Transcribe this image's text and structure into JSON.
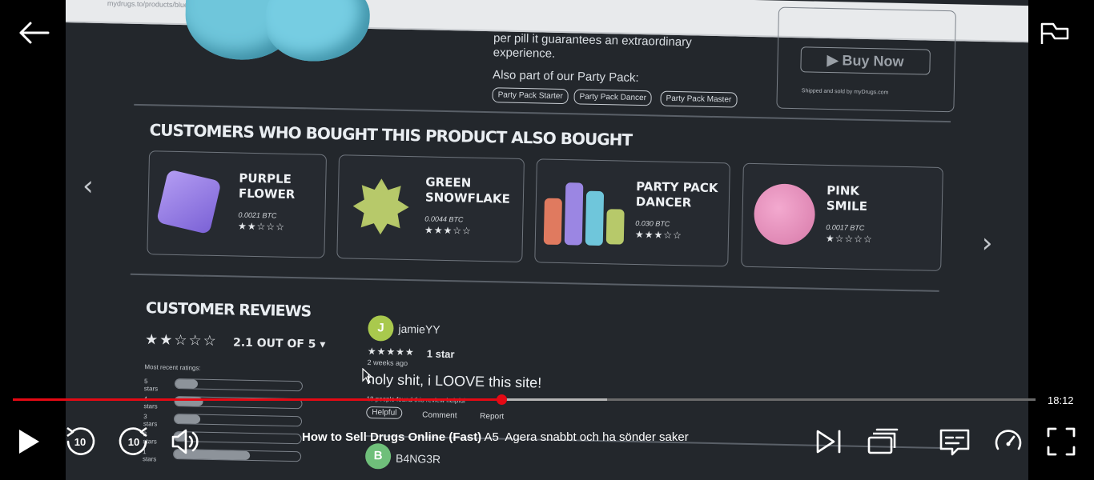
{
  "player": {
    "elapsed_fraction": 0.478,
    "buffered_fraction": 0.581,
    "remaining_time": "18:12",
    "show_title": "How to Sell Drugs Online (Fast)",
    "episode_code": "A5",
    "episode_title": "Agera snabbt och ha sönder saker",
    "skip_seconds": "10",
    "accent_color": "#e50914"
  },
  "video_frame": {
    "url": "mydrugs.to/products/blueclover",
    "description_lines": [
      "per pill it guarantees an extraordinary",
      "experience."
    ],
    "party_pack_title": "Also part of our Party Pack:",
    "party_pack_chips": [
      "Party Pack Starter",
      "Party Pack Dancer",
      "Party Pack Master"
    ],
    "buy_now": "Buy Now",
    "shipped_by": "Shipped and sold by myDrugs.com",
    "also_bought_title": "CUSTOMERS WHO BOUGHT THIS PRODUCT ALSO BOUGHT",
    "products": [
      {
        "name_line1": "PURPLE",
        "name_line2": "FLOWER",
        "price": "0.0021 BTC",
        "stars": "★★☆☆☆",
        "rating": 2
      },
      {
        "name_line1": "GREEN",
        "name_line2": "SNOWFLAKE",
        "price": "0.0044 BTC",
        "stars": "★★★☆☆",
        "rating": 3
      },
      {
        "name_line1": "PARTY PACK",
        "name_line2": "DANCER",
        "price": "0.030 BTC",
        "stars": "★★★☆☆",
        "rating": 3
      },
      {
        "name_line1": "PINK",
        "name_line2": "SMILE",
        "price": "0.0017 BTC",
        "stars": "★☆☆☆☆",
        "rating": 1
      }
    ],
    "reviews_title": "CUSTOMER REVIEWS",
    "overall_stars": "★★☆☆☆",
    "overall_score": "2.1 OUT OF 5",
    "most_recent_label": "Most recent ratings:",
    "rating_rows": [
      {
        "label": "5 stars",
        "fraction": 0.18
      },
      {
        "label": "4 stars",
        "fraction": 0.22
      },
      {
        "label": "3 stars",
        "fraction": 0.2
      },
      {
        "label": "2 stars",
        "fraction": 0.1
      },
      {
        "label": "1 stars",
        "fraction": 0.6
      }
    ],
    "reviews": [
      {
        "avatar": "J",
        "avatar_color": "#a9c94d",
        "user": "jamieYY",
        "stars": "★★★★★",
        "star_label": "1 star",
        "ago": "2 weeks ago",
        "text": "holy shit, i LOOVE this site!",
        "helpful_note": "18 people found this review helpful",
        "helpful": "Helpful",
        "comment": "Comment",
        "report": "Report"
      },
      {
        "avatar": "B",
        "avatar_color": "#6fbf7a",
        "user": "B4NG3R"
      }
    ]
  }
}
